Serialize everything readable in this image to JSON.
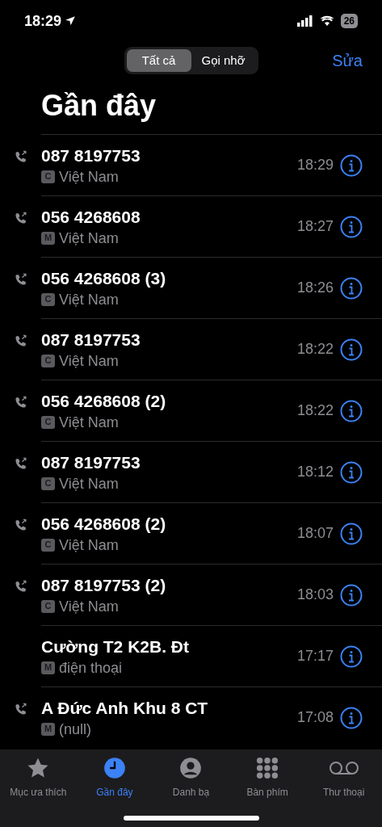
{
  "status_bar": {
    "time": "18:29",
    "battery": "26"
  },
  "segments": [
    {
      "label": "Tất cả",
      "selected": true
    },
    {
      "label": "Gọi nhỡ",
      "selected": false
    }
  ],
  "edit_button": "Sửa",
  "title": "Gần đây",
  "calls": [
    {
      "name": "087 8197753",
      "tag": "C",
      "detail": "Việt Nam",
      "time": "18:29",
      "outgoing": true
    },
    {
      "name": "056 4268608",
      "tag": "M",
      "detail": "Việt Nam",
      "time": "18:27",
      "outgoing": true
    },
    {
      "name": "056 4268608 (3)",
      "tag": "C",
      "detail": "Việt Nam",
      "time": "18:26",
      "outgoing": true
    },
    {
      "name": "087 8197753",
      "tag": "C",
      "detail": "Việt Nam",
      "time": "18:22",
      "outgoing": true
    },
    {
      "name": "056 4268608 (2)",
      "tag": "C",
      "detail": "Việt Nam",
      "time": "18:22",
      "outgoing": true
    },
    {
      "name": "087 8197753",
      "tag": "C",
      "detail": "Việt Nam",
      "time": "18:12",
      "outgoing": true
    },
    {
      "name": "056 4268608 (2)",
      "tag": "C",
      "detail": "Việt Nam",
      "time": "18:07",
      "outgoing": true
    },
    {
      "name": "087 8197753 (2)",
      "tag": "C",
      "detail": "Việt Nam",
      "time": "18:03",
      "outgoing": true
    },
    {
      "name": "Cường T2 K2B. Đt",
      "tag": "M",
      "detail": "điện thoại",
      "time": "17:17",
      "outgoing": false
    },
    {
      "name": "A Đức Anh Khu 8 CT",
      "tag": "M",
      "detail": "(null)",
      "time": "17:08",
      "outgoing": true
    }
  ],
  "tab_bar": [
    {
      "kind": "star",
      "label": "Mục ưa thích",
      "selected": false
    },
    {
      "kind": "clock",
      "label": "Gần đây",
      "selected": true
    },
    {
      "kind": "person",
      "label": "Danh bạ",
      "selected": false
    },
    {
      "kind": "keypad",
      "label": "Bàn phím",
      "selected": false
    },
    {
      "kind": "voicemail",
      "label": "Thư thoại",
      "selected": false
    }
  ]
}
